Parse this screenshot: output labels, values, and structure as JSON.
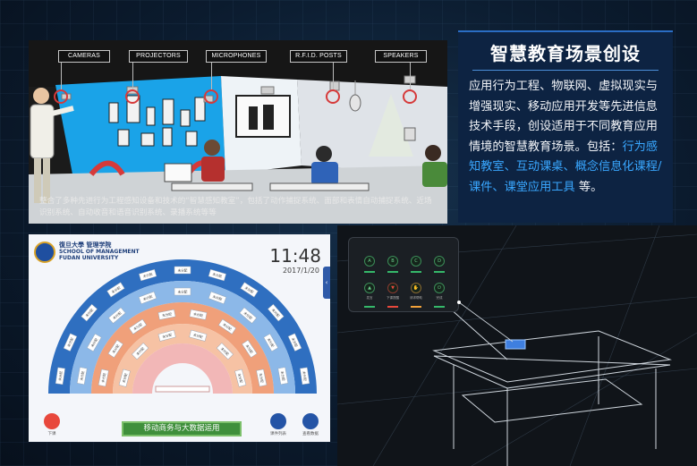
{
  "scene": {
    "device_labels": [
      "CAMERAS",
      "PROJECTORS",
      "MICROPHONES",
      "R.F.I.D. POSTS",
      "SPEAKERS"
    ],
    "caption": "整合了多种先进行为工程感知设备和技术的“智慧感知教室”，包括了动作捕捉系统、面部和表情自动捕捉系统、近场识别系统、自动收音和语音识别系统、录播系统等等"
  },
  "info": {
    "title": "智慧教育场景创设",
    "body_plain": "应用行为工程、物联网、虚拟现实与增强现实、移动应用开发等先进信息技术手段，创设适用于不同教育应用情境的智慧教育场景。包括：",
    "highlight_1": "行为感知教室",
    "sep_1": "、",
    "highlight_2": "互动课桌",
    "sep_2": "、",
    "highlight_3": "概念信息化课程/课件",
    "sep_3": "、",
    "highlight_4": "课堂应用工具",
    "tail": " 等。"
  },
  "app": {
    "school_cn": "復旦大學 管理学院",
    "school_en_1": "SCHOOL OF MANAGEMENT",
    "school_en_2": "FUDAN UNIVERSITY",
    "time": "11:48",
    "date": "2017/1/20",
    "seat_label": "未分配",
    "course_button": "移动商务与大数据运用",
    "left_btn_caption": "下课",
    "right_btn_1_caption": "课件列表",
    "right_btn_2_caption": "查看数据"
  },
  "holo": {
    "key_row_1": [
      "A",
      "B",
      "C",
      "D"
    ],
    "key_row_2_captions": [
      "发言",
      "下课提醒",
      "请求帮助",
      "完成"
    ]
  },
  "colors": {
    "accent_blue": "#39a7ff",
    "panel_navy": "#0d2342",
    "app_blue": "#2f5aa8",
    "app_orange": "#f0a07a",
    "app_pink": "#f2b7b7",
    "key_green": "#35b86a",
    "alert_red": "#d63a3a"
  }
}
